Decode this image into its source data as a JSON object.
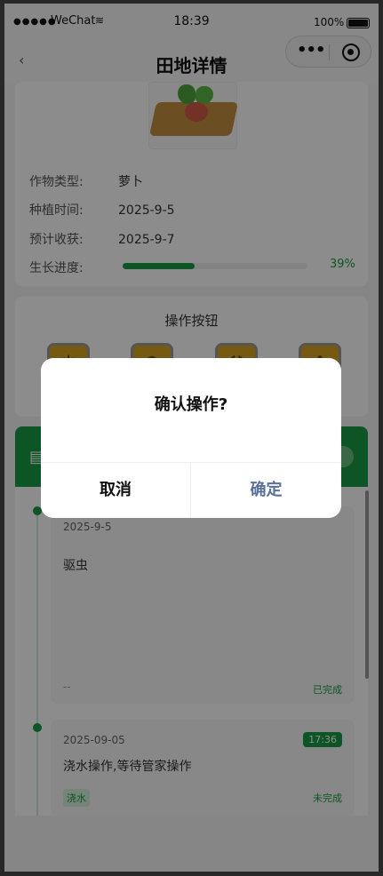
{
  "status_bar": {
    "signal": "●●●●●",
    "carrier": "WeChat",
    "wifi": "≋",
    "time": "18:39",
    "battery": "100%"
  },
  "nav": {
    "back": "‹",
    "title": "田地详情",
    "capsule_more": "•••"
  },
  "field": {
    "crop_type_label": "作物类型:",
    "crop_type": "萝卜",
    "plant_time_label": "种植时间:",
    "plant_time": "2025-9-5",
    "harvest_label": "预计收获:",
    "harvest": "2025-9-7",
    "progress_label": "生长进度:",
    "progress_value": 0.39,
    "progress_text": "39%"
  },
  "operations": {
    "title": "操作按钮"
  },
  "logs": [
    {
      "date": "2025-9-5",
      "desc": "驱虫",
      "dash": "--",
      "status": "已完成"
    },
    {
      "date": "2025-09-05",
      "time": "17:36",
      "desc": "浇水操作,等待管家操作",
      "tag": "浇水",
      "status": "未完成"
    }
  ],
  "modal": {
    "title": "确认操作?",
    "cancel": "取消",
    "confirm": "确定"
  },
  "colors": {
    "accent": "#1a9b46",
    "confirm_text": "#5b6f9c",
    "operation_button": "#d9a520"
  }
}
